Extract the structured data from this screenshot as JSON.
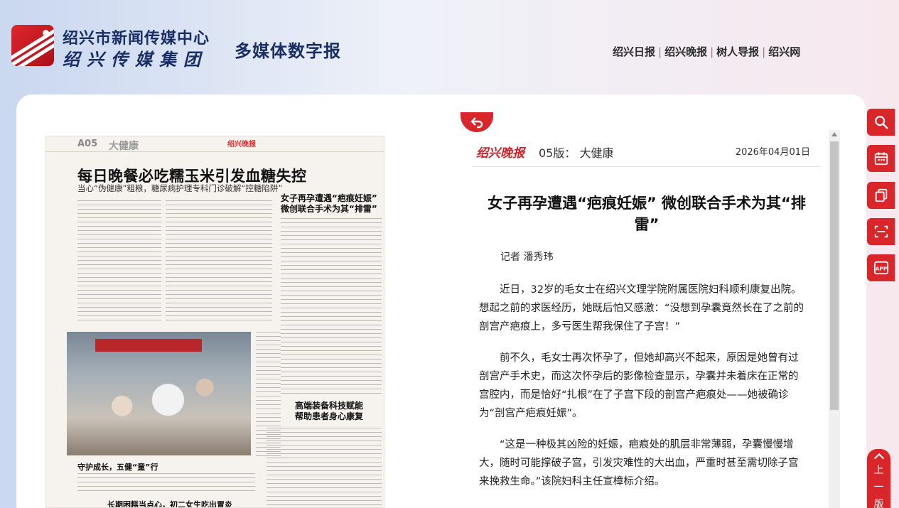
{
  "header": {
    "org_name": "绍兴市新闻传媒中心",
    "group_name": "绍兴传媒集团",
    "product": "多媒体数字报",
    "links": [
      "绍兴日报",
      "绍兴晚报",
      "树人导报",
      "绍兴网"
    ]
  },
  "paper_thumb": {
    "page_code": "A05",
    "section": "大健康",
    "brand": "绍兴晚报",
    "headline": "每日晚餐必吃糯玉米引发血糖失控",
    "subhead": "当心“伪健康”粗粮，糖尿病护理专科门诊破解“控糖陷阱”",
    "side_title_1": [
      "女子再孕遭遇“疤痕妊娠”",
      "微创联合手术为其“排雷”"
    ],
    "side_title_2": [
      "高端装备科技赋能",
      "帮助患者身心康复"
    ],
    "photo_caption": "守护成长，五健“童”行",
    "bottom_title": "长期困糕当点心，初二女生吃出胃炎"
  },
  "article": {
    "brand": "绍兴晚报",
    "edition": "05版： 大健康",
    "date": "2026年04月01日",
    "title": "女子再孕遭遇“疤痕妊娠” 微创联合手术为其“排雷”",
    "byline": "记者 潘秀玮",
    "paragraphs": [
      "近日，32岁的毛女士在绍兴文理学院附属医院妇科顺利康复出院。想起之前的求医经历，她既后怕又感激：“没想到孕囊竟然长在了之前的剖宫产疤痕上，多亏医生帮我保住了子宫！”",
      "前不久，毛女士再次怀孕了，但她却高兴不起来，原因是她曾有过剖宫产手术史，而这次怀孕后的影像检查显示，孕囊并未着床在正常的宫腔内，而是恰好“扎根”在了子宫下段的剖宫产疤痕处——她被确诊为“剖宫产疤痕妊娠”。",
      "“这是一种极其凶险的妊娠，疤痕处的肌层非常薄弱，孕囊慢慢增大，随时可能撑破子宫，引发灾难性的大出血，严重时甚至需切除子宫来挽救生命。”该院妇科主任宣樟标介绍。"
    ]
  },
  "tools": {
    "next_page_label": "上一版"
  },
  "colors": {
    "accent": "#d8262b",
    "brand_blue": "#1a2e66"
  }
}
